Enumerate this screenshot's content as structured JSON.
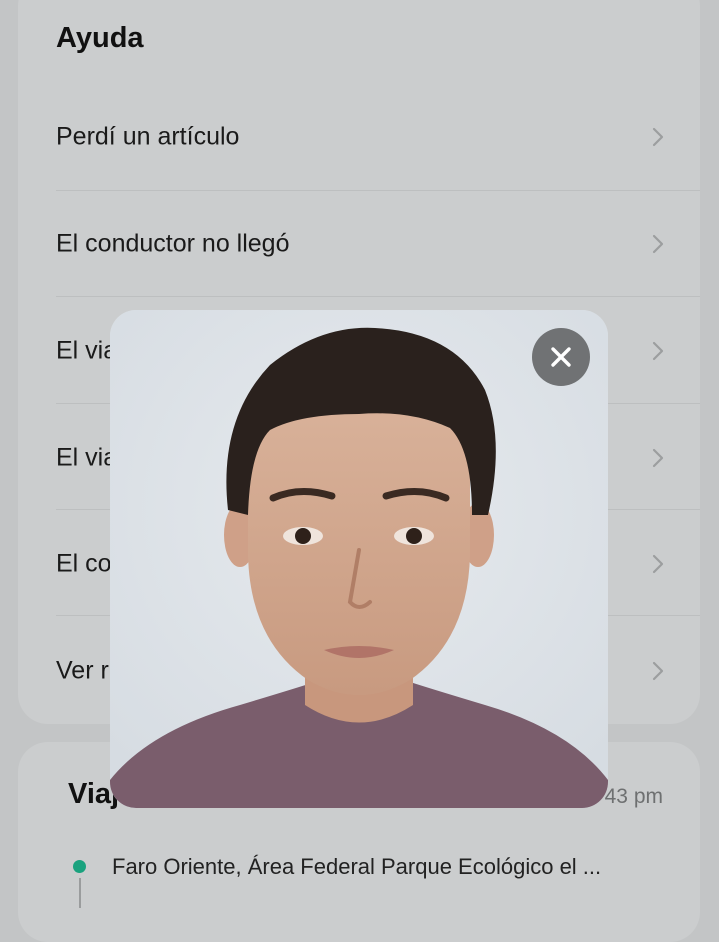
{
  "help": {
    "title": "Ayuda",
    "items": [
      {
        "label": "Perdí un artículo"
      },
      {
        "label": "El conductor no llegó"
      },
      {
        "label": "El via"
      },
      {
        "label": "El via"
      },
      {
        "label": "El co"
      },
      {
        "label": "Ver r"
      }
    ]
  },
  "trip": {
    "title": "Viaj",
    "time": "43 pm",
    "origin": "Faro Oriente, Área Federal Parque Ecológico el ..."
  },
  "photo_modal": {
    "icons": {
      "close": "close-icon",
      "photo": "driver-photo"
    },
    "colors": {
      "close_bg": "#707274",
      "background": "#dde2e7"
    }
  }
}
